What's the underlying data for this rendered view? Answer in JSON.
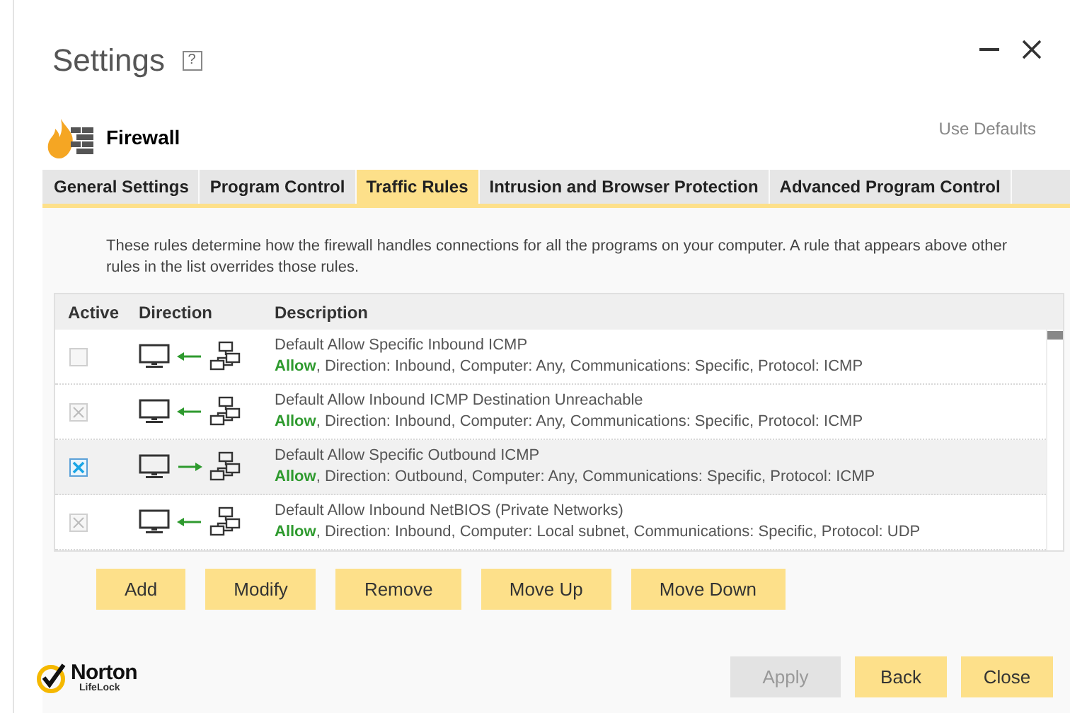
{
  "window": {
    "title": "Settings",
    "help": "?"
  },
  "header": {
    "title": "Firewall",
    "use_defaults": "Use Defaults"
  },
  "tabs": [
    {
      "label": "General Settings",
      "selected": false
    },
    {
      "label": "Program Control",
      "selected": false
    },
    {
      "label": "Traffic Rules",
      "selected": true
    },
    {
      "label": "Intrusion and Browser Protection",
      "selected": false
    },
    {
      "label": "Advanced Program Control",
      "selected": false
    }
  ],
  "intro": "These rules determine how the firewall handles connections for all the programs on your computer. A rule that appears above other rules in the list overrides those rules.",
  "table": {
    "columns": [
      "Active",
      "Direction",
      "Description"
    ],
    "rows": [
      {
        "active": false,
        "checked": false,
        "selected": false,
        "kind": "inbound",
        "name": "Default Allow Specific Inbound ICMP",
        "action": "Allow",
        "details": ", Direction: Inbound, Computer: Any, Communications: Specific, Protocol: ICMP"
      },
      {
        "active": false,
        "checked": true,
        "selected": false,
        "kind": "inbound",
        "name": "Default Allow Inbound ICMP Destination Unreachable",
        "action": "Allow",
        "details": ", Direction: Inbound, Computer: Any, Communications: Specific, Protocol: ICMP"
      },
      {
        "active": true,
        "checked": true,
        "selected": true,
        "kind": "outbound",
        "name": "Default Allow Specific Outbound ICMP",
        "action": "Allow",
        "details": ", Direction: Outbound, Computer: Any, Communications: Specific, Protocol: ICMP"
      },
      {
        "active": false,
        "checked": true,
        "selected": false,
        "kind": "inbound",
        "name": "Default Allow Inbound NetBIOS (Private Networks)",
        "action": "Allow",
        "details": ", Direction: Inbound, Computer: Local subnet, Communications: Specific, Protocol: UDP"
      }
    ]
  },
  "rule_buttons": [
    "Add",
    "Modify",
    "Remove",
    "Move Up",
    "Move Down"
  ],
  "logo": {
    "name": "Norton",
    "sub": "LifeLock"
  },
  "footer_buttons": [
    {
      "label": "Apply",
      "disabled": true
    },
    {
      "label": "Back",
      "disabled": false
    },
    {
      "label": "Close",
      "disabled": false
    }
  ]
}
